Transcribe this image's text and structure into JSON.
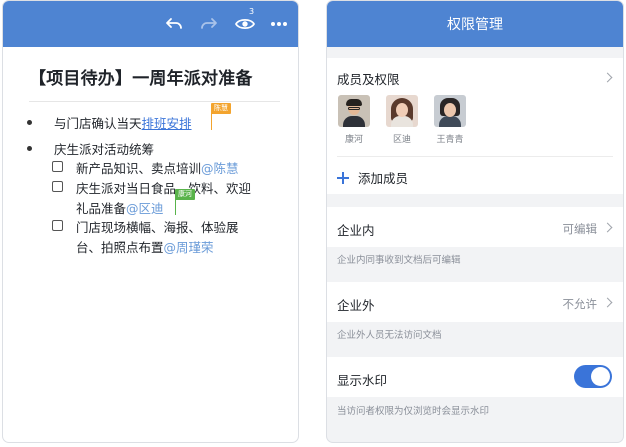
{
  "editor": {
    "toolbar": {
      "undo_icon": "undo-icon",
      "redo_icon": "redo-icon",
      "view_icon": "eye-icon",
      "viewer_count": "3",
      "more_icon": "more-icon"
    },
    "title": "【项目待办】一周年派对准备",
    "items": [
      {
        "prefix": "与门店确认当天",
        "link": "排班安排",
        "collab_tag": "陈慧"
      },
      {
        "text": "庆生派对活动统筹"
      }
    ],
    "todos": [
      {
        "text": "新产品知识、卖点培训",
        "mention": "@陈慧",
        "checked": false
      },
      {
        "line1": "庆生派对当日食品、饮料、欢迎",
        "line2": "礼品准备",
        "mention": "@区迪",
        "collab_tag": "康河",
        "checked": false
      },
      {
        "line1": "门店现场横幅、海报、体验展",
        "line2": "台、拍照点布置",
        "mention": "@周瑾荣",
        "checked": false
      }
    ]
  },
  "permissions": {
    "title": "权限管理",
    "members_label": "成员及权限",
    "members": [
      {
        "name": "康河",
        "avatar": "male-avatar"
      },
      {
        "name": "区迪",
        "avatar": "female-avatar"
      },
      {
        "name": "王青青",
        "avatar": "female-avatar"
      }
    ],
    "add_member_label": "添加成员",
    "internal": {
      "label": "企业内",
      "value": "可编辑",
      "hint": "企业内同事收到文档后可编辑"
    },
    "external": {
      "label": "企业外",
      "value": "不允许",
      "hint": "企业外人员无法访问文档"
    },
    "watermark": {
      "label": "显示水印",
      "enabled": true,
      "hint": "当访问者权限为仅浏览时会显示水印"
    },
    "colors": {
      "accent": "#3a74d9",
      "header": "#4e84d2"
    }
  }
}
